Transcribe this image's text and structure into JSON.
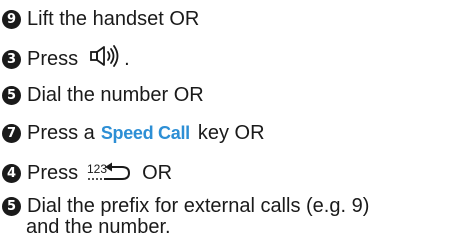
{
  "steps": [
    {
      "number": "9",
      "parts": [
        "Lift the handset OR"
      ]
    },
    {
      "number": "3",
      "parts": [
        "Press",
        "."
      ]
    },
    {
      "number": "5",
      "parts": [
        "Dial the number OR"
      ]
    },
    {
      "number": "7",
      "parts": [
        "Press a",
        "Speed Call",
        "key OR"
      ]
    },
    {
      "number": "4",
      "parts": [
        "Press",
        "OR"
      ]
    },
    {
      "number": "5",
      "parts": [
        "Dial the prefix for external calls (e.g. 9)",
        "and the number."
      ]
    }
  ],
  "icons": {
    "speaker": "speaker-icon",
    "redial": "redial-icon",
    "redial_text": "123"
  },
  "colors": {
    "text": "#1a1a1a",
    "speed_call": "#2d8fd5",
    "badge_bg": "#1a1a1a",
    "badge_fg": "#ffffff"
  }
}
